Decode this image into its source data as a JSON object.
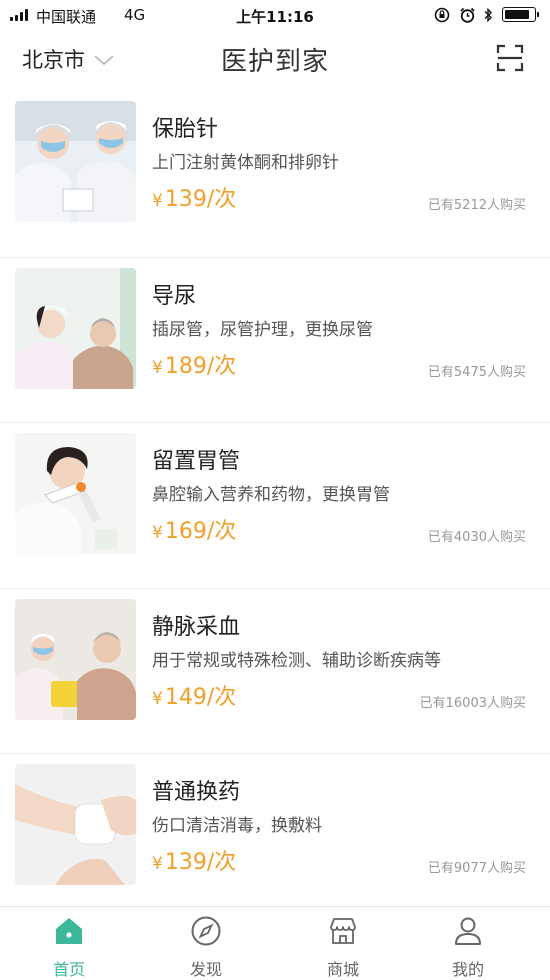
{
  "status_bar": {
    "carrier": "中国联通",
    "network": "4G",
    "time": "上午11:16"
  },
  "header": {
    "city": "北京市",
    "title": "医护到家"
  },
  "services": [
    {
      "name": "保胎针",
      "desc": "上门注射黄体酮和排卵针",
      "currency": "¥",
      "price": "139/次",
      "sold": "已有5212人购买"
    },
    {
      "name": "导尿",
      "desc": "插尿管，尿管护理，更换尿管",
      "currency": "¥",
      "price": "189/次",
      "sold": "已有5475人购买"
    },
    {
      "name": "留置胃管",
      "desc": "鼻腔输入营养和药物，更换胃管",
      "currency": "¥",
      "price": "169/次",
      "sold": "已有4030人购买"
    },
    {
      "name": "静脉采血",
      "desc": "用于常规或特殊检测、辅助诊断疾病等",
      "currency": "¥",
      "price": "149/次",
      "sold": "已有16003人购买"
    },
    {
      "name": "普通换药",
      "desc": "伤口清洁消毒，换敷料",
      "currency": "¥",
      "price": "139/次",
      "sold": "已有9077人购买"
    }
  ],
  "tabs": [
    {
      "label": "首页",
      "icon": "home-icon"
    },
    {
      "label": "发现",
      "icon": "compass-icon"
    },
    {
      "label": "商城",
      "icon": "store-icon"
    },
    {
      "label": "我的",
      "icon": "person-icon"
    }
  ],
  "colors": {
    "accent": "#3bb89a",
    "price": "#f0a02a"
  }
}
